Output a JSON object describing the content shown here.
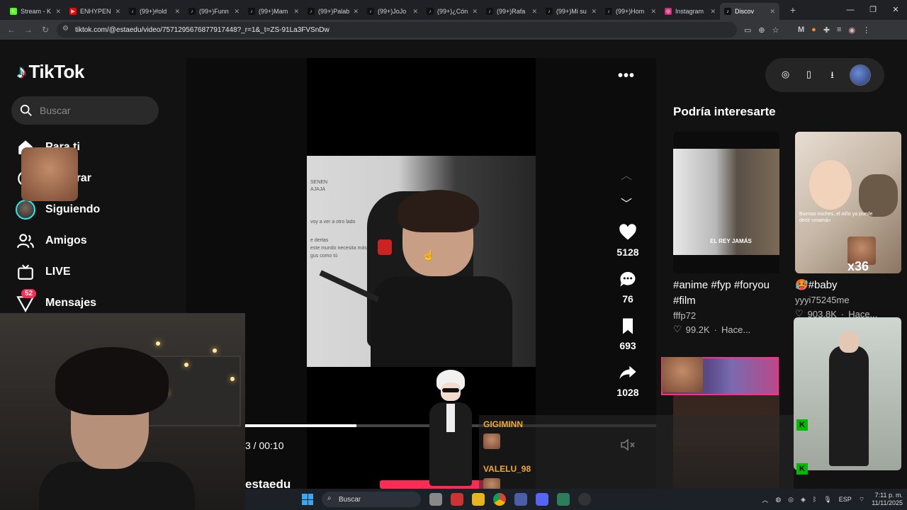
{
  "browser": {
    "tabs": [
      {
        "title": "Stream - K",
        "fav_color": "#53fc18",
        "fav_char": "K"
      },
      {
        "title": "ENHYPEN",
        "fav_color": "#ff0000",
        "fav_char": "▶"
      },
      {
        "title": "(99+)#old",
        "fav_color": "#111111",
        "fav_char": "♪"
      },
      {
        "title": "(99+)Funn",
        "fav_color": "#111111",
        "fav_char": "♪"
      },
      {
        "title": "(99+)Mam",
        "fav_color": "#111111",
        "fav_char": "♪"
      },
      {
        "title": "(99+)Palab",
        "fav_color": "#111111",
        "fav_char": "♪"
      },
      {
        "title": "(99+)JoJo",
        "fav_color": "#111111",
        "fav_char": "♪"
      },
      {
        "title": "(99+)¿Cón",
        "fav_color": "#111111",
        "fav_char": "♪"
      },
      {
        "title": "(99+)Rafa",
        "fav_color": "#111111",
        "fav_char": "♪"
      },
      {
        "title": "(99+)Mi su",
        "fav_color": "#111111",
        "fav_char": "♪"
      },
      {
        "title": "(99+)Hom",
        "fav_color": "#111111",
        "fav_char": "♪"
      },
      {
        "title": "Instagram",
        "fav_color": "#d62976",
        "fav_char": "◎"
      },
      {
        "title": "Discov",
        "fav_color": "#111111",
        "fav_char": "♪",
        "active": true
      }
    ],
    "url": "tiktok.com/@estaedu/video/7571295676877917448?_r=1&_t=ZS-91La3FVSnDw"
  },
  "sidebar": {
    "brand": "TikTok",
    "search_placeholder": "Buscar",
    "items": [
      {
        "label": "Para ti"
      },
      {
        "label": "Explorar"
      },
      {
        "label": "Siguiendo"
      },
      {
        "label": "Amigos"
      },
      {
        "label": "LIVE"
      },
      {
        "label": "Mensajes",
        "badge": "52"
      }
    ]
  },
  "video": {
    "overlay_lines": [
      "SENEN",
      "AJAJA",
      "voy a ver a otro lado",
      "e dertas",
      "este mundo necesita más",
      "gus como tú"
    ],
    "likes": "5128",
    "comments": "76",
    "saves": "693",
    "shares": "1028",
    "progress": 0.27,
    "time": "3 / 00:10",
    "author": "estaedu"
  },
  "recommendations": {
    "title": "Podría interesarte",
    "cards": [
      {
        "caption": "#anime #fyp #foryou #film",
        "user": "fffp72",
        "likes": "99.2K",
        "time": "Hace...",
        "thumb_text": "EL REY JAMÁS"
      },
      {
        "caption": "🥵#baby",
        "user": "yyyi75245me",
        "likes": "903.8K",
        "time": "Hace...",
        "thumb_text": "Buenas noches, el niño ya puede decir «mamá»",
        "multiplier": "x36"
      }
    ]
  },
  "chat": [
    {
      "name": "GIGIMINN"
    },
    {
      "name": "VALELU_98"
    }
  ],
  "taskbar": {
    "search": "Buscar",
    "lang": "ESP",
    "time": "7:11 p. m.",
    "date": "11/11/2025"
  }
}
